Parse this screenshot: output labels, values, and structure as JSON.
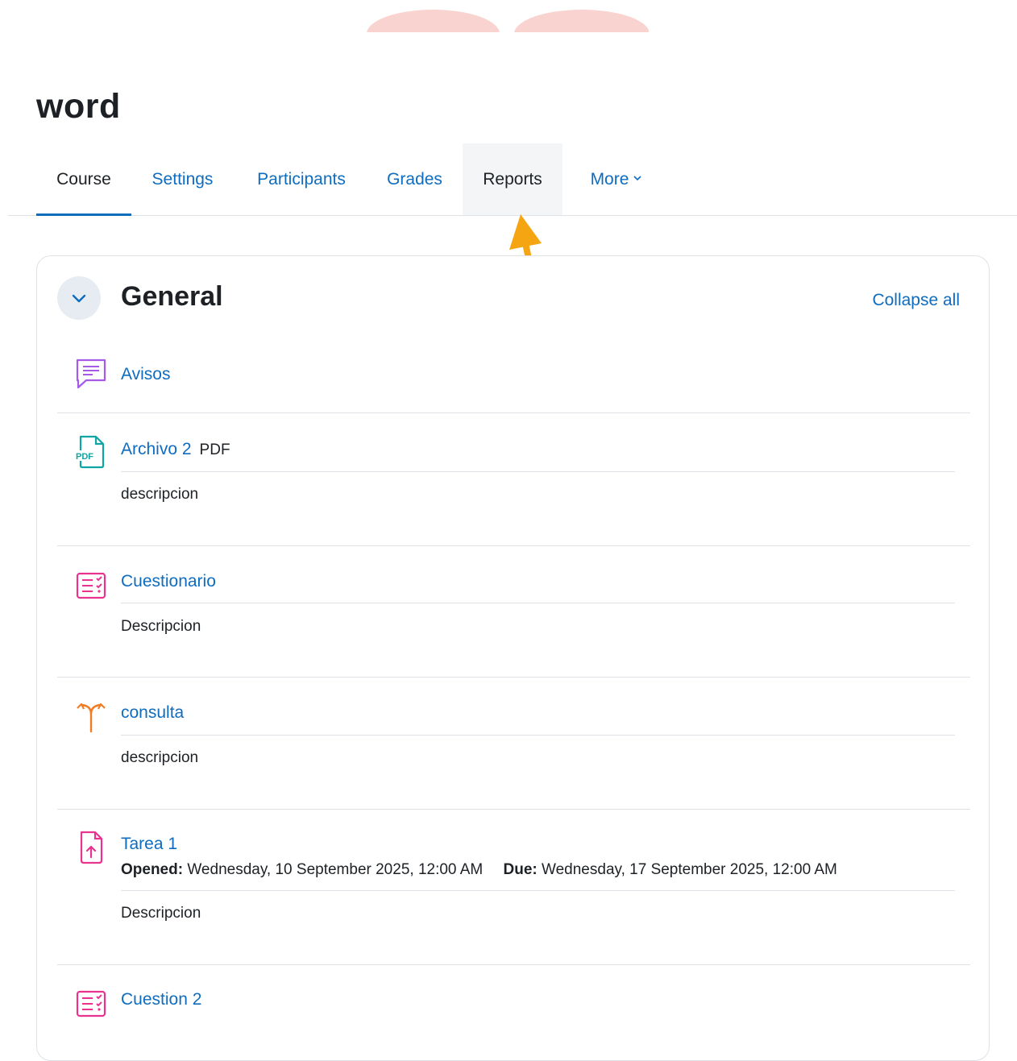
{
  "course": {
    "title": "word"
  },
  "tabs": [
    {
      "label": "Course"
    },
    {
      "label": "Settings"
    },
    {
      "label": "Participants"
    },
    {
      "label": "Grades"
    },
    {
      "label": "Reports"
    },
    {
      "label": "More"
    }
  ],
  "section": {
    "title": "General",
    "collapse_label": "Collapse all"
  },
  "activities": [
    {
      "name": "Avisos",
      "icon": "forum-icon"
    },
    {
      "name": "Archivo 2",
      "type_label": "PDF",
      "description": "descripcion",
      "icon": "pdf-file-icon"
    },
    {
      "name": "Cuestionario",
      "description": "Descripcion",
      "icon": "quiz-icon"
    },
    {
      "name": "consulta",
      "description": "descripcion",
      "icon": "choice-icon"
    },
    {
      "name": "Tarea 1",
      "opened_label": "Opened:",
      "opened_value": "Wednesday, 10 September 2025, 12:00 AM",
      "due_label": "Due:",
      "due_value": "Wednesday, 17 September 2025, 12:00 AM",
      "description": "Descripcion",
      "icon": "assignment-upload-icon"
    },
    {
      "name": "Cuestion 2",
      "icon": "quiz-icon"
    }
  ],
  "colors": {
    "link": "#0f6cbf",
    "arrow": "#f5a511",
    "forum": "#a55ae8",
    "resource": "#0fa5a5",
    "assessment": "#e8348e",
    "collaboration": "#f07c24"
  }
}
